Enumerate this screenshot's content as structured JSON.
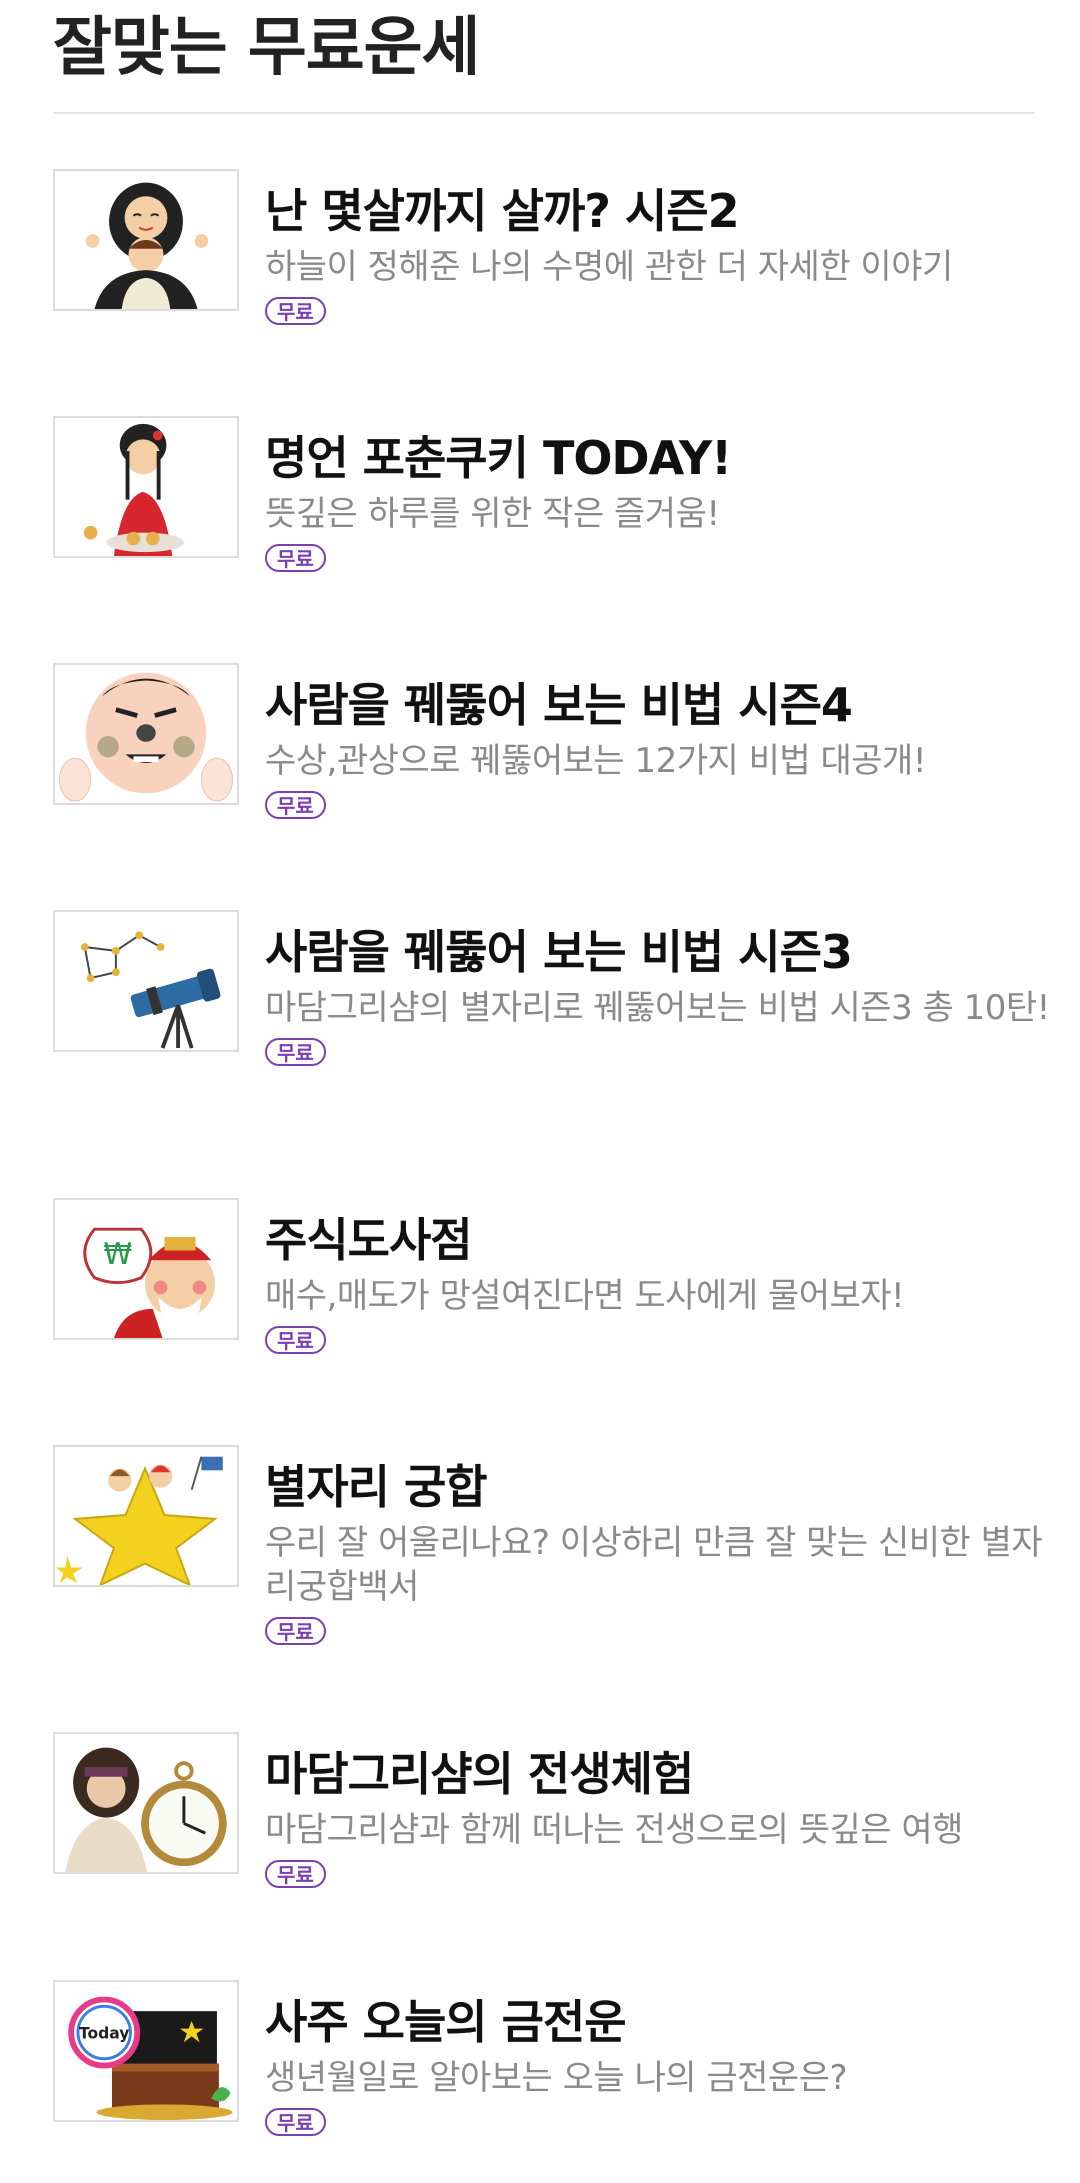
{
  "page": {
    "title": "잘맞는 무료운세"
  },
  "items": [
    {
      "title": "난 몇살까지 살까? 시즌2",
      "desc": "하늘이 정해준 나의 수명에 관한 더 자세한 이야기",
      "badge": "무료",
      "icon": "long-life-couple-icon"
    },
    {
      "title": "명언 포춘쿠키 TODAY!",
      "desc": "뜻깊은 하루를 위한 작은 즐거움!",
      "badge": "무료",
      "icon": "fortune-cookie-lady-icon"
    },
    {
      "title": "사람을 꿰뚫어 보는 비법 시즌4",
      "desc": "수상,관상으로 꿰뚫어보는 12가지 비법 대공개!",
      "badge": "무료",
      "icon": "face-reading-icon"
    },
    {
      "title": "사람을 꿰뚫어 보는 비법 시즌3",
      "desc": "마담그리샴의 별자리로 꿰뚫어보는 비법 시즌3 총 10탄!",
      "badge": "무료",
      "icon": "telescope-constellation-icon"
    },
    {
      "title": "주식도사점",
      "desc": "매수,매도가 망설여진다면 도사에게 물어보자!",
      "badge": "무료",
      "icon": "money-sage-icon"
    },
    {
      "title": "별자리 궁합",
      "desc": "우리 잘 어울리나요? 이상하리 만큼 잘 맞는 신비한 별자리궁합백서",
      "badge": "무료",
      "icon": "star-couple-icon"
    },
    {
      "title": "마담그리샴의 전생체험",
      "desc": "마담그리샴과 함께 떠나는 전생으로의 뜻깊은 여행",
      "badge": "무료",
      "icon": "pocket-watch-fortune-teller-icon"
    },
    {
      "title": "사주 오늘의 금전운",
      "desc": "생년월일로 알아보는 오늘 나의 금전운은?",
      "badge": "무료",
      "icon": "treasure-chest-today-icon"
    }
  ]
}
